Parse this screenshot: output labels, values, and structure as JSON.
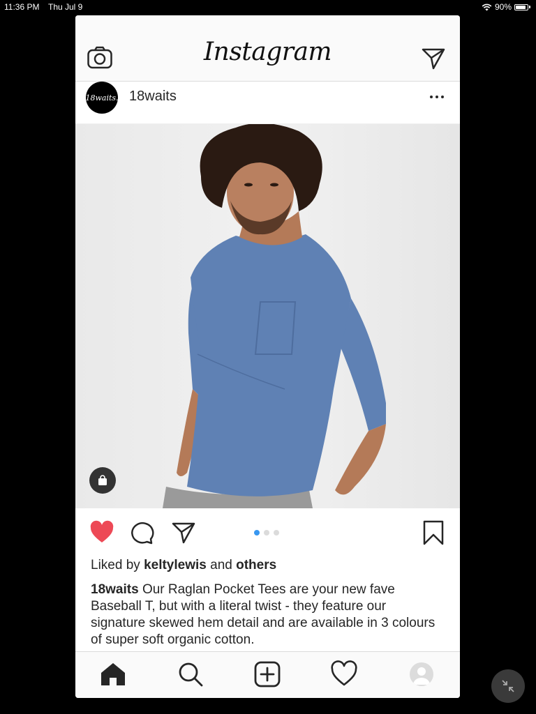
{
  "status_bar": {
    "time": "11:36 PM",
    "date": "Thu Jul 9",
    "battery": "90%",
    "battery_level": 0.9
  },
  "top_nav": {
    "logo": "Instagram",
    "left_icon": "camera-icon",
    "right_icon": "direct-send-icon"
  },
  "post": {
    "avatar_text": "18waits.",
    "username": "18waits",
    "liked_by_prefix": "Liked by",
    "liked_by_user": "keltylewis",
    "liked_by_and": "and",
    "liked_by_others": "others",
    "caption_user": "18waits",
    "caption_text": "Our Raglan Pocket Tees are your new fave Baseball T, but with a literal twist - they feature our signature skewed hem detail and are available in 3 colours of super soft organic cotton.",
    "carousel_count": 3,
    "carousel_active": 1,
    "liked": true
  },
  "tab_bar": {
    "items": [
      "home-icon",
      "search-icon",
      "add-post-icon",
      "activity-heart-icon",
      "profile-icon"
    ],
    "active": "home-icon"
  },
  "colors": {
    "like_red": "#ed4956",
    "active_dot": "#3897f0",
    "text": "#262626",
    "shirt_blue": "#5f81b4"
  }
}
